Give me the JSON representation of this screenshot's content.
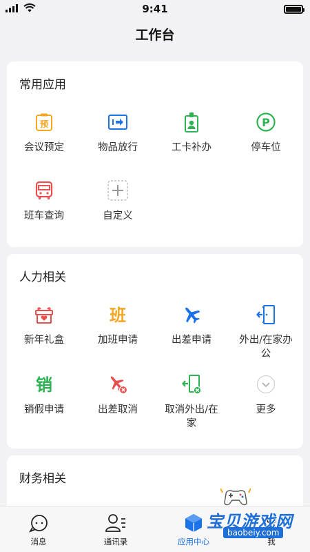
{
  "status_bar": {
    "time": "9:41"
  },
  "nav": {
    "title": "工作台"
  },
  "sections": [
    {
      "title": "常用应用",
      "items": [
        {
          "label": "会议预定",
          "icon": "meeting-reserve-icon",
          "color": "#f5a623",
          "glyph": "预"
        },
        {
          "label": "物品放行",
          "icon": "item-release-icon",
          "color": "#1a73e8"
        },
        {
          "label": "工卡补办",
          "icon": "badge-reissue-icon",
          "color": "#2db352"
        },
        {
          "label": "停车位",
          "icon": "parking-icon",
          "color": "#2db352",
          "glyph": "P"
        },
        {
          "label": "班车查询",
          "icon": "shuttle-bus-icon",
          "color": "#e85050"
        },
        {
          "label": "自定义",
          "icon": "add-custom-icon",
          "color": "#999999"
        }
      ]
    },
    {
      "title": "人力相关",
      "items": [
        {
          "label": "新年礼盒",
          "icon": "gift-box-icon",
          "color": "#e85050"
        },
        {
          "label": "加班申请",
          "icon": "overtime-icon",
          "color": "#f5a623",
          "glyph": "班"
        },
        {
          "label": "出差申请",
          "icon": "airplane-icon",
          "color": "#1a73e8"
        },
        {
          "label": "外出/在家办公",
          "icon": "go-out-icon",
          "color": "#1a73e8"
        },
        {
          "label": "销假申请",
          "icon": "cancel-leave-icon",
          "color": "#2db352",
          "glyph": "销"
        },
        {
          "label": "出差取消",
          "icon": "cancel-trip-icon",
          "color": "#e85050"
        },
        {
          "label": "取消外出/在家",
          "icon": "cancel-go-out-icon",
          "color": "#2db352"
        },
        {
          "label": "更多",
          "icon": "chevron-down-icon",
          "color": "#bbbbbb"
        }
      ]
    },
    {
      "title": "财务相关"
    }
  ],
  "tabs": [
    {
      "label": "消息",
      "icon": "message-bubble-icon",
      "active": false
    },
    {
      "label": "通讯录",
      "icon": "contacts-icon",
      "active": false
    },
    {
      "label": "应用中心",
      "icon": "app-center-icon",
      "active": true
    },
    {
      "label": "我",
      "icon": "profile-icon",
      "active": false
    }
  ],
  "watermark": {
    "text": "宝贝游戏网",
    "url": "baobeiy.com"
  }
}
